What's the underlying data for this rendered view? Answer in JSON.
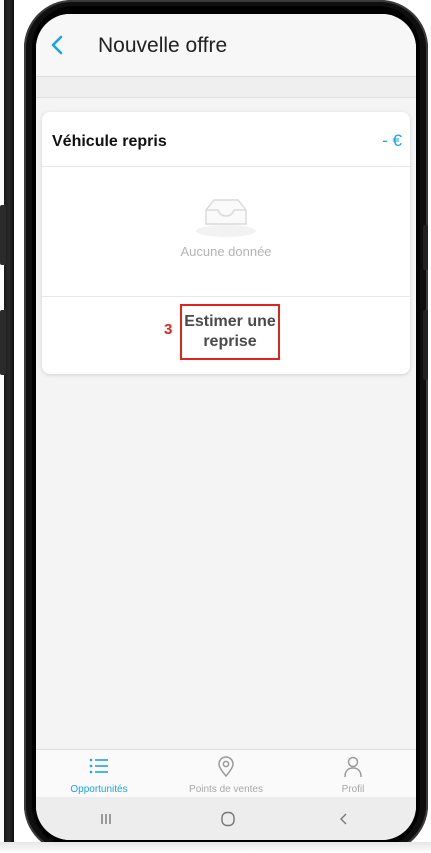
{
  "header": {
    "title": "Nouvelle offre",
    "back_icon": "chevron-left-icon"
  },
  "card": {
    "title": "Véhicule repris",
    "amount": "- €",
    "empty_icon": "inbox-icon",
    "empty_text": "Aucune donnée",
    "step_number": "3",
    "action_label": "Estimer une reprise"
  },
  "bottom_nav": {
    "items": [
      {
        "label": "Opportunités",
        "icon": "list-icon",
        "active": true
      },
      {
        "label": "Points de ventes",
        "icon": "location-pin-icon",
        "active": false
      },
      {
        "label": "Profil",
        "icon": "user-icon",
        "active": false
      }
    ]
  },
  "system_nav": {
    "icons": [
      "recent-apps-icon",
      "home-icon",
      "back-icon"
    ]
  },
  "colors": {
    "accent": "#1aa4e6",
    "highlight": "#e0241b"
  }
}
